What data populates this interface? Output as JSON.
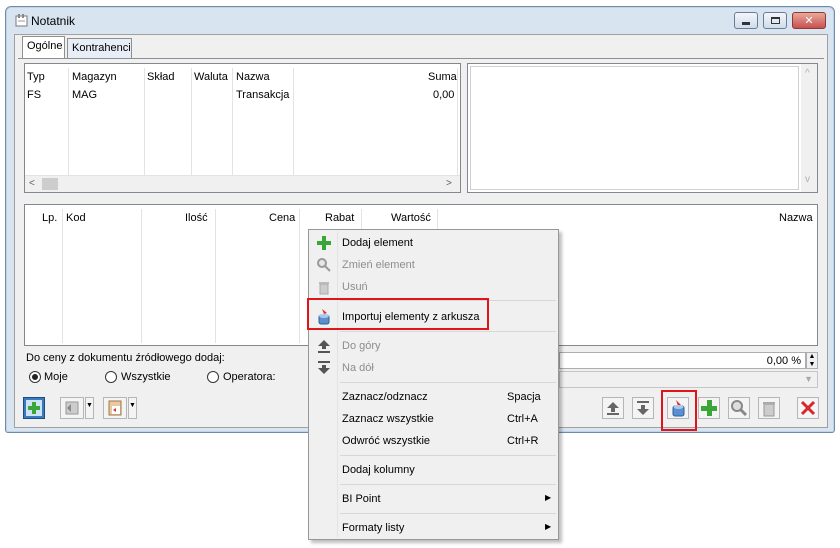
{
  "window": {
    "title": "Notatnik"
  },
  "tabs": [
    {
      "label": "Ogólne"
    },
    {
      "label": "Kontrahenci"
    }
  ],
  "top_grid": {
    "columns": [
      "Typ",
      "Magazyn",
      "Skład",
      "Waluta",
      "Nazwa",
      "Suma"
    ],
    "rows": [
      {
        "typ": "FS",
        "magazyn": "MAG",
        "sklad": "",
        "waluta": "",
        "nazwa": "Transakcja",
        "suma": "0,00"
      }
    ]
  },
  "items_grid": {
    "columns": [
      "Lp.",
      "Kod",
      "Ilość",
      "Cena",
      "Rabat",
      "Wartość",
      "Nazwa"
    ]
  },
  "bottom": {
    "price_label": "Do ceny z dokumentu źródłowego dodaj:",
    "radios": [
      {
        "label": "Moje",
        "checked": true
      },
      {
        "label": "Wszystkie",
        "checked": false
      },
      {
        "label": "Operatora:",
        "checked": false
      }
    ],
    "percent_value": "0,00 %"
  },
  "context_menu": {
    "items": [
      {
        "label": "Dodaj element",
        "icon": "plus-icon",
        "enabled": true
      },
      {
        "label": "Zmień element",
        "icon": "magnifier-icon",
        "enabled": false
      },
      {
        "label": "Usuń",
        "icon": "trash-icon",
        "enabled": false
      },
      {
        "label": "Importuj elementy z arkusza",
        "icon": "import-sheet-icon",
        "enabled": true
      },
      {
        "label": "Do góry",
        "icon": "move-up-icon",
        "enabled": false
      },
      {
        "label": "Na dół",
        "icon": "move-down-icon",
        "enabled": false
      },
      {
        "label": "Zaznacz/odznacz",
        "shortcut": "Spacja",
        "enabled": true
      },
      {
        "label": "Zaznacz wszystkie",
        "shortcut": "Ctrl+A",
        "enabled": true
      },
      {
        "label": "Odwróć wszystkie",
        "shortcut": "Ctrl+R",
        "enabled": true
      },
      {
        "label": "Dodaj kolumny",
        "enabled": true
      },
      {
        "label": "BI Point",
        "submenu": true,
        "enabled": true
      },
      {
        "label": "Formaty listy",
        "submenu": true,
        "enabled": true
      }
    ]
  },
  "colors": {
    "highlight_red": "#e0151c",
    "add_green": "#3aa63a",
    "delete_red": "#d8262a"
  }
}
